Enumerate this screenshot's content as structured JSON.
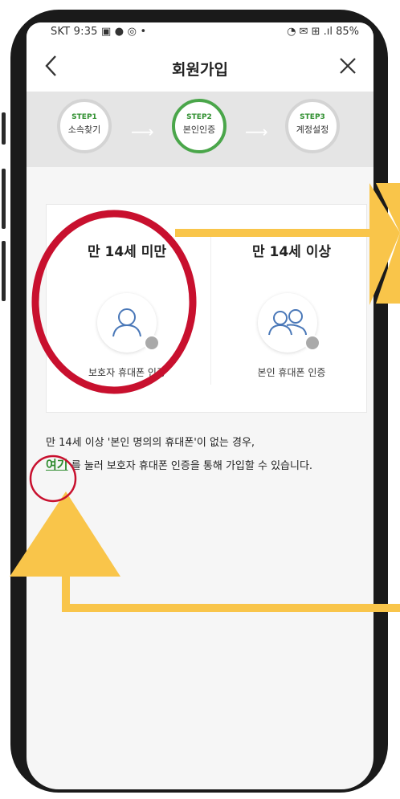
{
  "status_bar": {
    "left": "SKT 9:35 ▣ ● ◎ •",
    "right": "◔ ✉ ⊞ .ıl 85%"
  },
  "header": {
    "title": "회원가입",
    "back_icon": "chevron-left-icon",
    "close_icon": "close-icon"
  },
  "steps": [
    {
      "num": "STEP1",
      "label": "소속찾기",
      "active": false
    },
    {
      "num": "STEP2",
      "label": "본인인증",
      "active": true
    },
    {
      "num": "STEP3",
      "label": "계정설정",
      "active": false
    }
  ],
  "options": [
    {
      "heading": "만 14세 미만",
      "caption": "보호자 휴대폰 인증",
      "icon": "single-user-icon"
    },
    {
      "heading": "만 14세 이상",
      "caption": "본인 휴대폰 인증",
      "icon": "two-users-icon"
    }
  ],
  "notice": {
    "line1": "만 14세 이상 '본인 명의의 휴대폰'이 없는 경우,",
    "link": "여기",
    "line2_rest": " 를 눌러 보호자 휴대폰 인증을 통해 가입할 수 있습니다."
  },
  "colors": {
    "accent_green": "#4aa64a",
    "annotation_red": "#c8102e",
    "annotation_yellow": "#f9c54a"
  }
}
